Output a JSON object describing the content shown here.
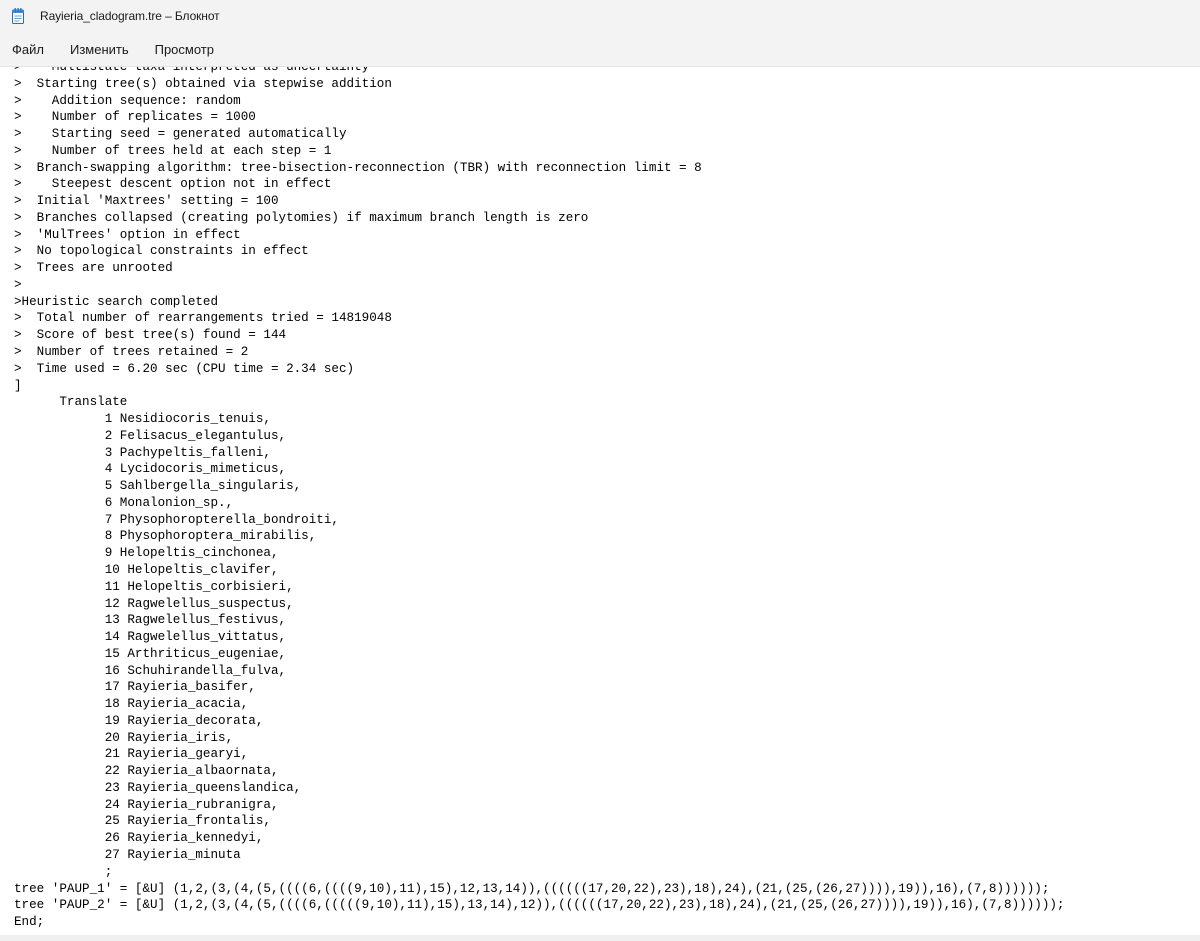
{
  "window": {
    "title": "Rayieria_cladogram.tre – Блокнот",
    "app_icon": "notepad-icon"
  },
  "menu": {
    "file": "Файл",
    "edit": "Изменить",
    "view": "Просмотр"
  },
  "editor": {
    "lines": [
      ">    Multistate taxa interpreted as uncertainty",
      ">  Starting tree(s) obtained via stepwise addition",
      ">    Addition sequence: random",
      ">    Number of replicates = 1000",
      ">    Starting seed = generated automatically",
      ">    Number of trees held at each step = 1",
      ">  Branch-swapping algorithm: tree-bisection-reconnection (TBR) with reconnection limit = 8",
      ">    Steepest descent option not in effect",
      ">  Initial 'Maxtrees' setting = 100",
      ">  Branches collapsed (creating polytomies) if maximum branch length is zero",
      ">  'MulTrees' option in effect",
      ">  No topological constraints in effect",
      ">  Trees are unrooted",
      ">",
      ">Heuristic search completed",
      ">  Total number of rearrangements tried = 14819048",
      ">  Score of best tree(s) found = 144",
      ">  Number of trees retained = 2",
      ">  Time used = 6.20 sec (CPU time = 2.34 sec)",
      "]",
      "      Translate",
      "            1 Nesidiocoris_tenuis,",
      "            2 Felisacus_elegantulus,",
      "            3 Pachypeltis_falleni,",
      "            4 Lycidocoris_mimeticus,",
      "            5 Sahlbergella_singularis,",
      "            6 Monalonion_sp.,",
      "            7 Physophoropterella_bondroiti,",
      "            8 Physophoroptera_mirabilis,",
      "            9 Helopeltis_cinchonea,",
      "            10 Helopeltis_clavifer,",
      "            11 Helopeltis_corbisieri,",
      "            12 Ragwelellus_suspectus,",
      "            13 Ragwelellus_festivus,",
      "            14 Ragwelellus_vittatus,",
      "            15 Arthriticus_eugeniae,",
      "            16 Schuhirandella_fulva,",
      "            17 Rayieria_basifer,",
      "            18 Rayieria_acacia,",
      "            19 Rayieria_decorata,",
      "            20 Rayieria_iris,",
      "            21 Rayieria_gearyi,",
      "            22 Rayieria_albaornata,",
      "            23 Rayieria_queenslandica,",
      "            24 Rayieria_rubranigra,",
      "            25 Rayieria_frontalis,",
      "            26 Rayieria_kennedyi,",
      "            27 Rayieria_minuta",
      "            ;",
      "tree 'PAUP_1' = [&U] (1,2,(3,(4,(5,((((6,((((9,10),11),15),12,13,14)),((((((17,20,22),23),18),24),(21,(25,(26,27)))),19)),16),(7,8))))));",
      "tree 'PAUP_2' = [&U] (1,2,(3,(4,(5,((((6,(((((9,10),11),15),13,14),12)),((((((17,20,22),23),18),24),(21,(25,(26,27)))),19)),16),(7,8))))));",
      "End;"
    ]
  }
}
